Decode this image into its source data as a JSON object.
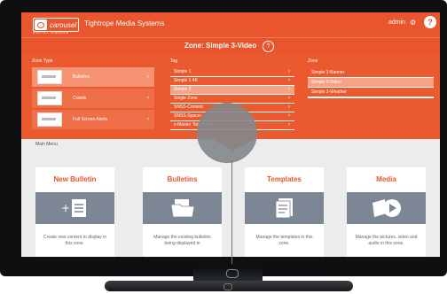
{
  "header": {
    "logo_text": "carousel",
    "logo_sub": "DIGITAL SIGNAGE",
    "app_title": "Tightrope Media Systems",
    "user": "admin",
    "help_glyph": "?"
  },
  "zone": {
    "title": "Zone: Simple 3-Video",
    "help_glyph": "?"
  },
  "columns": {
    "zone_type_label": "Zone Type",
    "tag_label": "Tag",
    "zone_label": "Zone"
  },
  "zone_types": [
    {
      "label": "Bulletins",
      "selected": true
    },
    {
      "label": "Crawls",
      "selected": false
    },
    {
      "label": "Full Screen Alerts",
      "selected": false
    }
  ],
  "tags": [
    {
      "label": "Simple 1",
      "selected": false
    },
    {
      "label": "Simple 1 4K",
      "selected": false
    },
    {
      "label": "Simple 3",
      "selected": true
    },
    {
      "label": "Single Zone",
      "selected": false
    },
    {
      "label": "SNSS-Content",
      "selected": false
    },
    {
      "label": "SNSS-Spacer",
      "selected": false
    },
    {
      "label": "z-Master Templates",
      "selected": false
    }
  ],
  "zones": [
    {
      "label": "Simple 3-Banner",
      "selected": false
    },
    {
      "label": "Simple 3-Video",
      "selected": true
    },
    {
      "label": "Simple 3-Weather",
      "selected": false
    }
  ],
  "main_menu_label": "Main Menu",
  "cards": [
    {
      "title": "New Bulletin",
      "icon": "new-bulletin-icon",
      "desc": "Create new content to display in this zone."
    },
    {
      "title": "Bulletins",
      "icon": "folder-icon",
      "desc": "Manage the existing bulletins being displayed in"
    },
    {
      "title": "Templates",
      "icon": "templates-icon",
      "desc": "Manage the templates in this zone."
    },
    {
      "title": "Media",
      "icon": "media-icon",
      "desc": "Manage the pictures, video and audio in this zone."
    }
  ],
  "colors": {
    "accent": "#e9552c",
    "card_image": "#7c8694"
  }
}
